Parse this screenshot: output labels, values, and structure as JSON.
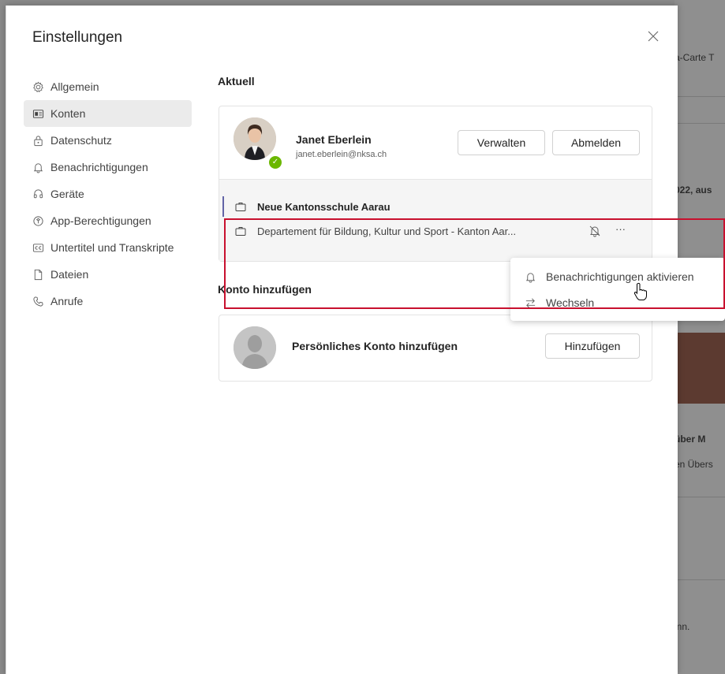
{
  "background": {
    "snippets": [
      "a-Carte T",
      "022, aus",
      "über M",
      "en Übers",
      "inn."
    ]
  },
  "dialog": {
    "title": "Einstellungen",
    "close_icon": "close-icon"
  },
  "nav": {
    "items": [
      {
        "label": "Allgemein",
        "icon": "gear-icon"
      },
      {
        "label": "Konten",
        "icon": "id-card-icon",
        "active": true
      },
      {
        "label": "Datenschutz",
        "icon": "lock-icon"
      },
      {
        "label": "Benachrichtigungen",
        "icon": "bell-icon"
      },
      {
        "label": "Geräte",
        "icon": "headset-icon"
      },
      {
        "label": "App-Berechtigungen",
        "icon": "shield-icon"
      },
      {
        "label": "Untertitel und Transkripte",
        "icon": "captions-icon"
      },
      {
        "label": "Dateien",
        "icon": "file-icon"
      },
      {
        "label": "Anrufe",
        "icon": "phone-icon"
      }
    ]
  },
  "current": {
    "section_label": "Aktuell",
    "user_name": "Janet Eberlein",
    "user_email": "janet.eberlein@nksa.ch",
    "manage_label": "Verwalten",
    "signout_label": "Abmelden",
    "orgs": [
      {
        "label": "Neue Kantonsschule Aarau",
        "bold": true
      },
      {
        "label": "Departement für Bildung, Kultur und Sport - Kanton Aar..."
      }
    ],
    "more_label": "···"
  },
  "add_account": {
    "section_label": "Konto hinzufügen",
    "label": "Persönliches Konto hinzufügen",
    "button_label": "Hinzufügen"
  },
  "context_menu": {
    "items": [
      {
        "label": "Benachrichtigungen aktivieren",
        "icon": "bell-icon"
      },
      {
        "label": "Wechseln",
        "icon": "switch-arrows-icon"
      }
    ]
  },
  "colors": {
    "accent": "#6264a7",
    "status_available": "#6bb700",
    "highlight": "#c8102e"
  }
}
